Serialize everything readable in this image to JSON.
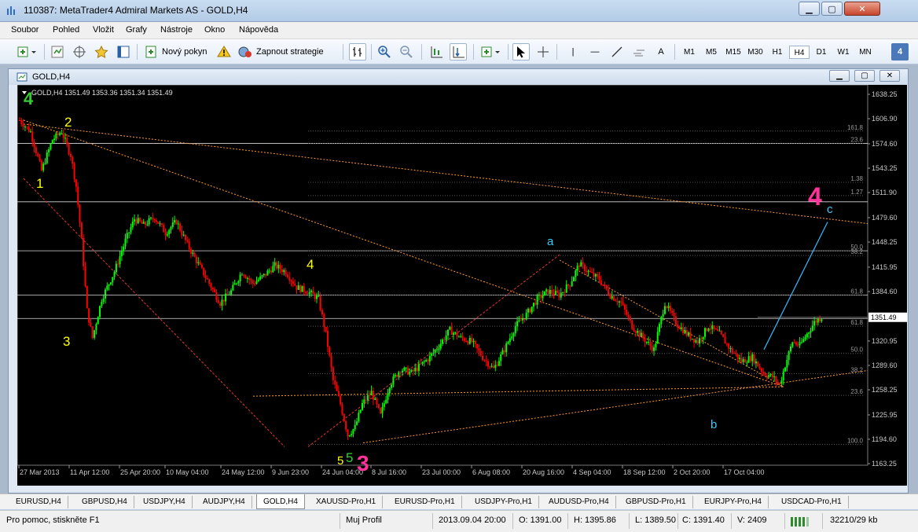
{
  "window": {
    "title": "110387: MetaTrader4 Admiral Markets AS - GOLD,H4",
    "minimize": "▁",
    "maximize": "▢",
    "close": "✕"
  },
  "menu": [
    "Soubor",
    "Pohled",
    "Vložit",
    "Grafy",
    "Nástroje",
    "Okno",
    "Nápověda"
  ],
  "toolbar": {
    "new_order_label": "Nový pokyn",
    "strategy_label": "Zapnout strategie",
    "line_tool": "|",
    "hline_tool": "—",
    "text_tool": "A",
    "timeframes": [
      "M1",
      "M5",
      "M15",
      "M30",
      "H1",
      "H4",
      "D1",
      "W1",
      "MN"
    ],
    "active_timeframe": "H4",
    "badge": "4"
  },
  "chart_window": {
    "title": "GOLD,H4",
    "minimize": "▁",
    "maximize": "▢",
    "close": "✕"
  },
  "chart_data": {
    "type": "candlestick",
    "header": "GOLD,H4  1351.49 1353.36 1351.34 1351.49",
    "current_price": "1351.49",
    "ylim": [
      1163.25,
      1638.25
    ],
    "y_ticks": [
      "1638.25",
      "1606.90",
      "1574.60",
      "1543.25",
      "1511.90",
      "1479.60",
      "1448.25",
      "1415.95",
      "1384.60",
      "1351.49",
      "1320.95",
      "1289.60",
      "1258.25",
      "1225.95",
      "1194.60",
      "1163.25"
    ],
    "x_ticks": [
      "27 Mar 2013",
      "11 Apr 12:00",
      "25 Apr 20:00",
      "10 May 04:00",
      "24 May 12:00",
      "9 Jun 23:00",
      "24 Jun 04:00",
      "8 Jul 16:00",
      "23 Jul 00:00",
      "6 Aug 08:00",
      "20 Aug 16:00",
      "4 Sep 04:00",
      "18 Sep 12:00",
      "2 Oct 20:00",
      "17 Oct 04:00"
    ],
    "price_path": [
      [
        0,
        1605
      ],
      [
        6,
        1590
      ],
      [
        12,
        1540
      ],
      [
        18,
        1580
      ],
      [
        23,
        1590
      ],
      [
        28,
        1560
      ],
      [
        31,
        1520
      ],
      [
        34,
        1450
      ],
      [
        37,
        1360
      ],
      [
        40,
        1325
      ],
      [
        45,
        1375
      ],
      [
        52,
        1410
      ],
      [
        58,
        1450
      ],
      [
        63,
        1478
      ],
      [
        68,
        1470
      ],
      [
        74,
        1480
      ],
      [
        80,
        1460
      ],
      [
        86,
        1475
      ],
      [
        92,
        1445
      ],
      [
        98,
        1420
      ],
      [
        104,
        1395
      ],
      [
        110,
        1370
      ],
      [
        116,
        1385
      ],
      [
        122,
        1410
      ],
      [
        128,
        1395
      ],
      [
        134,
        1405
      ],
      [
        140,
        1418
      ],
      [
        146,
        1410
      ],
      [
        152,
        1390
      ],
      [
        158,
        1385
      ],
      [
        164,
        1375
      ],
      [
        168,
        1330
      ],
      [
        172,
        1270
      ],
      [
        176,
        1240
      ],
      [
        180,
        1200
      ],
      [
        184,
        1210
      ],
      [
        188,
        1240
      ],
      [
        193,
        1255
      ],
      [
        198,
        1225
      ],
      [
        203,
        1265
      ],
      [
        209,
        1285
      ],
      [
        215,
        1280
      ],
      [
        220,
        1290
      ],
      [
        225,
        1300
      ],
      [
        230,
        1315
      ],
      [
        236,
        1335
      ],
      [
        242,
        1325
      ],
      [
        248,
        1320
      ],
      [
        254,
        1300
      ],
      [
        260,
        1285
      ],
      [
        266,
        1310
      ],
      [
        272,
        1340
      ],
      [
        278,
        1355
      ],
      [
        284,
        1375
      ],
      [
        290,
        1385
      ],
      [
        296,
        1380
      ],
      [
        302,
        1395
      ],
      [
        307,
        1420
      ],
      [
        312,
        1410
      ],
      [
        318,
        1400
      ],
      [
        324,
        1380
      ],
      [
        330,
        1370
      ],
      [
        336,
        1340
      ],
      [
        342,
        1325
      ],
      [
        348,
        1310
      ],
      [
        354,
        1370
      ],
      [
        360,
        1345
      ],
      [
        366,
        1330
      ],
      [
        372,
        1320
      ],
      [
        378,
        1340
      ],
      [
        384,
        1330
      ],
      [
        390,
        1310
      ],
      [
        396,
        1295
      ],
      [
        402,
        1300
      ],
      [
        408,
        1280
      ],
      [
        413,
        1275
      ],
      [
        417,
        1265
      ],
      [
        420,
        1290
      ],
      [
        424,
        1320
      ],
      [
        428,
        1315
      ],
      [
        432,
        1330
      ],
      [
        436,
        1345
      ],
      [
        440,
        1352
      ]
    ],
    "fib_levels": [
      {
        "label": "161.8",
        "price": 1591
      },
      {
        "label": "23.6",
        "price": 1575
      },
      {
        "label": "1.38",
        "price": 1525
      },
      {
        "label": "1.27",
        "price": 1508
      },
      {
        "label": "50.0",
        "price": 1437
      },
      {
        "label": "38.2",
        "price": 1431
      },
      {
        "label": "61.8",
        "price": 1380
      },
      {
        "label": "61.8",
        "price": 1340
      },
      {
        "label": "50.0",
        "price": 1305
      },
      {
        "label": "38.2",
        "price": 1279
      },
      {
        "label": "23.6",
        "price": 1251
      },
      {
        "label": "100.0",
        "price": 1188
      }
    ],
    "wave_labels": [
      {
        "text": "4",
        "color": "#33cc33"
      },
      {
        "text": "2",
        "color": "#ffff00"
      },
      {
        "text": "1",
        "color": "#ffff00"
      },
      {
        "text": "3",
        "color": "#ffff00"
      },
      {
        "text": "4",
        "color": "#ffff00"
      },
      {
        "text": "5",
        "color": "#ffff00"
      },
      {
        "text": "5",
        "color": "#33cc33"
      },
      {
        "text": "3",
        "color": "#ff3399"
      },
      {
        "text": "a",
        "color": "#33ccff"
      },
      {
        "text": "b",
        "color": "#33ccff"
      },
      {
        "text": "c",
        "color": "#33ccff"
      },
      {
        "text": "4",
        "color": "#ff3399"
      }
    ],
    "colors": {
      "bull": "#00ff00",
      "bear": "#ff0000",
      "background": "#000000",
      "axis_text": "#c8c8c8",
      "trendline": "#ff9a2e",
      "level": "#cfcfcf"
    }
  },
  "symbol_tabs": [
    "EURUSD,H4",
    "GBPUSD,H4",
    "USDJPY,H4",
    "AUDJPY,H4",
    "GOLD,H4",
    "XAUUSD-Pro,H1",
    "EURUSD-Pro,H1",
    "USDJPY-Pro,H1",
    "AUDUSD-Pro,H4",
    "GBPUSD-Pro,H1",
    "EURJPY-Pro,H4",
    "USDCAD-Pro,H1"
  ],
  "active_tab": "GOLD,H4",
  "status": {
    "help": "Pro pomoc, stiskněte F1",
    "profile": "Muj Profil",
    "datetime": "2013.09.04 20:00",
    "open": "O: 1391.00",
    "high": "H: 1395.86",
    "low": "L: 1389.50",
    "close": "C: 1391.40",
    "volume": "V: 2409",
    "traffic": "32210/29 kb"
  }
}
